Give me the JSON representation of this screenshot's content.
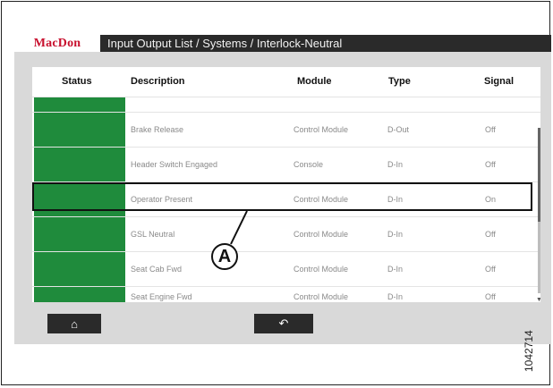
{
  "header": {
    "logo": "MacDon",
    "breadcrumb": "Input Output List / Systems / Interlock-Neutral"
  },
  "table": {
    "columns": [
      "Status",
      "Description",
      "Module",
      "Type",
      "Signal"
    ],
    "rows": [
      {
        "status_color": "#1f8b3c",
        "description": "",
        "module": "",
        "type": "",
        "signal": ""
      },
      {
        "status_color": "#1f8b3c",
        "description": "Brake Release",
        "module": "Control Module",
        "type": "D-Out",
        "signal": "Off"
      },
      {
        "status_color": "#1f8b3c",
        "description": "Header Switch Engaged",
        "module": "Console",
        "type": "D-In",
        "signal": "Off"
      },
      {
        "status_color": "#1f8b3c",
        "description": "Operator Present",
        "module": "Control Module",
        "type": "D-In",
        "signal": "On"
      },
      {
        "status_color": "#1f8b3c",
        "description": "GSL Neutral",
        "module": "Control Module",
        "type": "D-In",
        "signal": "Off"
      },
      {
        "status_color": "#1f8b3c",
        "description": "Seat Cab Fwd",
        "module": "Control Module",
        "type": "D-In",
        "signal": "Off"
      },
      {
        "status_color": "#1f8b3c",
        "description": "Seat Engine Fwd",
        "module": "Control Module",
        "type": "D-In",
        "signal": "Off"
      }
    ]
  },
  "buttons": {
    "home_icon": "home-icon",
    "back_icon": "back-arrow-icon",
    "home_glyph": "⌂",
    "back_glyph": "↶"
  },
  "callout": {
    "label": "A"
  },
  "figure_id": "1042714",
  "colors": {
    "header_bg": "#2a2a2a",
    "brand_red": "#c8102e",
    "status_green": "#1f8b3c",
    "screen_bg": "#d9d9d9"
  }
}
